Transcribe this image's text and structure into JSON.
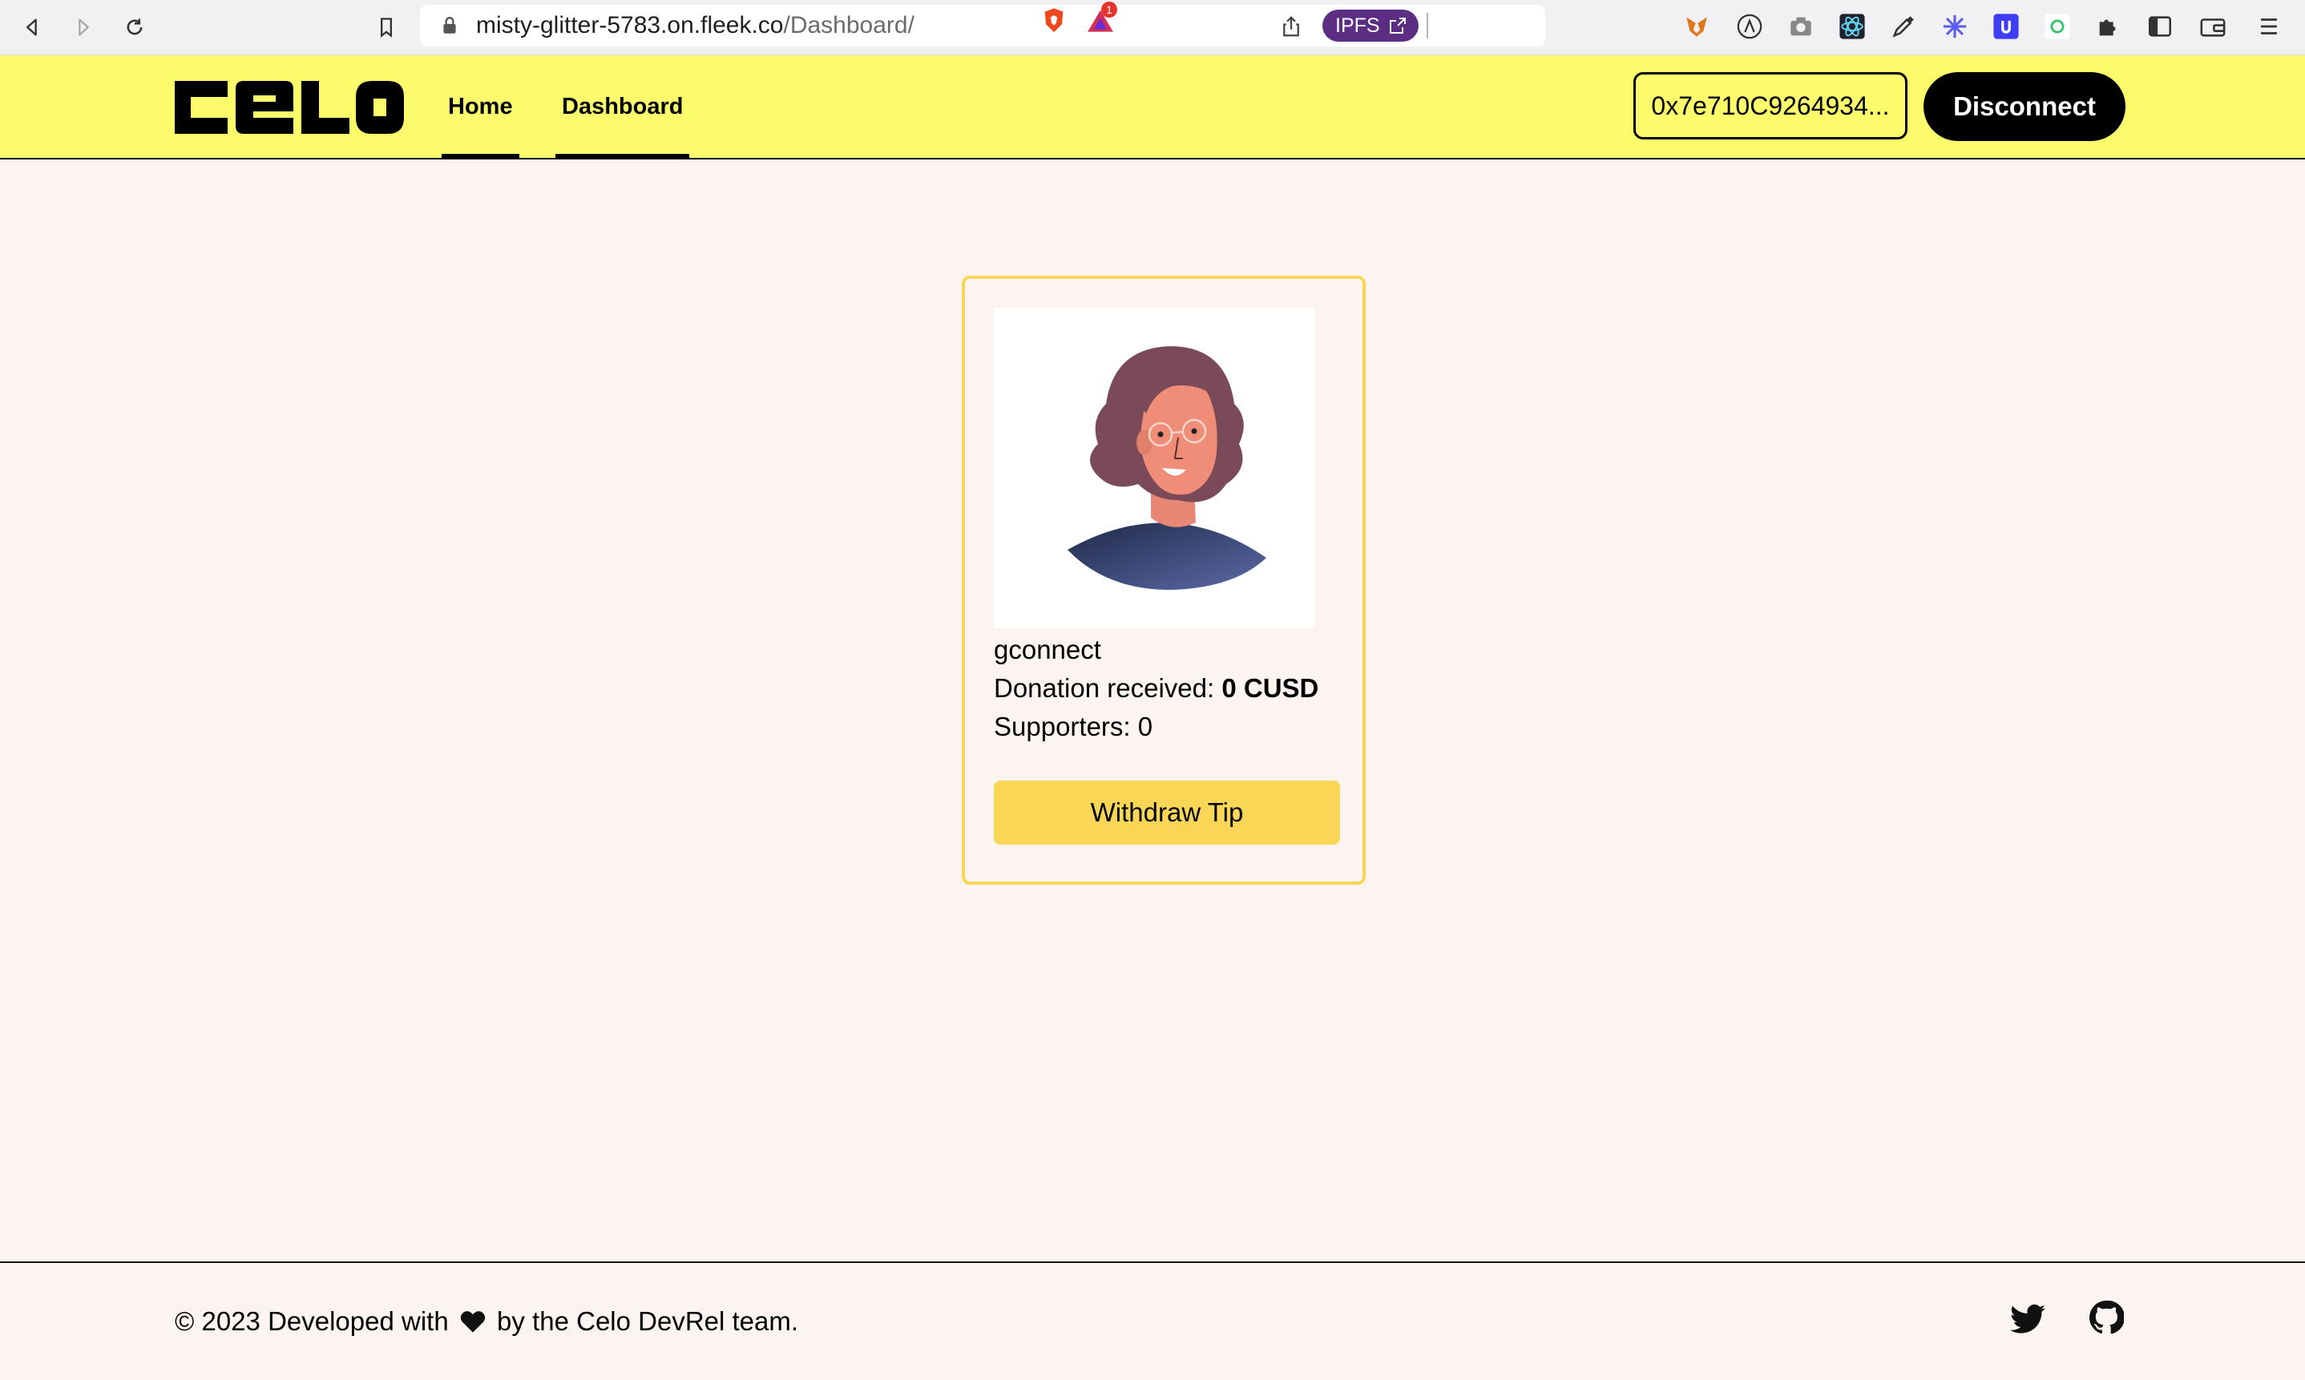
{
  "browser": {
    "url_host": "misty-glitter-5783.on.fleek.co",
    "url_path": "/Dashboard/",
    "ipfs_label": "IPFS",
    "rewards_badge": "1",
    "icons": [
      "back-icon",
      "forward-icon",
      "reload-icon",
      "bookmark-icon",
      "lock-icon",
      "share-icon",
      "external-link-icon",
      "brave-shields-icon",
      "brave-rewards-icon",
      "metamask-icon",
      "extension-icon",
      "camera-icon",
      "react-devtools-icon",
      "eyedropper-icon",
      "snowflake-icon",
      "extension-icon",
      "extension-icon",
      "puzzle-icon",
      "sidebar-icon",
      "wallet-icon",
      "menu-icon"
    ]
  },
  "header": {
    "logo_text": "CELO",
    "nav": [
      {
        "label": "Home"
      },
      {
        "label": "Dashboard"
      }
    ],
    "address": "0x7e710C9264934...",
    "disconnect_label": "Disconnect",
    "accent_color": "#fcfb6b"
  },
  "card": {
    "name": "gconnect",
    "donation_label": "Donation received:",
    "donation_value": "0 CUSD",
    "supporters_label": "Supporters:",
    "supporters_value": "0",
    "withdraw_label": "Withdraw Tip",
    "border_color": "#fad656"
  },
  "footer": {
    "text_prefix": "© 2023 Developed with",
    "text_suffix": "by the Celo DevRel team.",
    "icons": [
      "twitter-icon",
      "github-icon"
    ]
  }
}
